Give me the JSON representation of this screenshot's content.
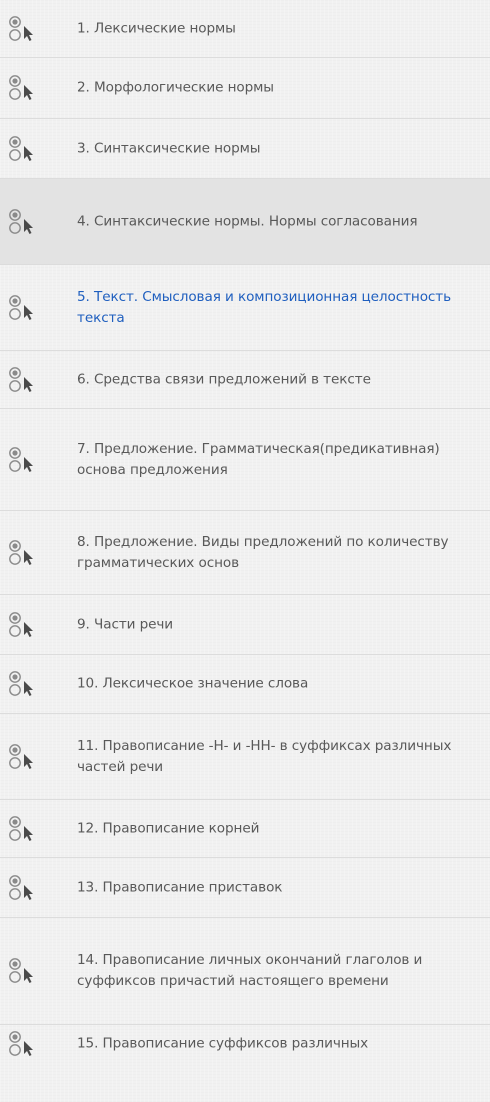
{
  "task_list": {
    "items": [
      {
        "label": "1. Лексические нормы",
        "icon": "task-icon"
      },
      {
        "label": "2. Морфологические нормы",
        "icon": "task-icon"
      },
      {
        "label": "3. Синтаксические нормы",
        "icon": "task-icon"
      },
      {
        "label": "4. Синтаксические нормы. Нормы согласования",
        "icon": "task-icon",
        "state": "hovered"
      },
      {
        "label": "5. Текст. Смысловая и композиционная целостность текста",
        "icon": "task-icon",
        "state": "active",
        "color": "#1f5fbf"
      },
      {
        "label": "6. Средства связи предложений в тексте",
        "icon": "task-icon"
      },
      {
        "label": "7. Предложение. Грамматическая(предикативная) основа предложения",
        "icon": "task-icon"
      },
      {
        "label": "8. Предложение. Виды предложений по количеству грамматических основ",
        "icon": "task-icon"
      },
      {
        "label": "9. Части речи",
        "icon": "task-icon"
      },
      {
        "label": "10. Лексическое значение слова",
        "icon": "task-icon"
      },
      {
        "label": "11. Правописание -Н- и -НН- в суффиксах различных частей речи",
        "icon": "task-icon"
      },
      {
        "label": "12. Правописание корней",
        "icon": "task-icon"
      },
      {
        "label": "13. Правописание приставок",
        "icon": "task-icon"
      },
      {
        "label": "14. Правописание личных окончаний глаголов и суффиксов причастий настоящего времени",
        "icon": "task-icon"
      },
      {
        "label": "15. Правописание суффиксов различных",
        "icon": "task-icon"
      }
    ]
  },
  "colors": {
    "text": "#595959",
    "active_text": "#1f5fbf",
    "hover_background": "#e3e3e3",
    "separator": "#dcdcdc",
    "background": "#f1f1f1"
  }
}
